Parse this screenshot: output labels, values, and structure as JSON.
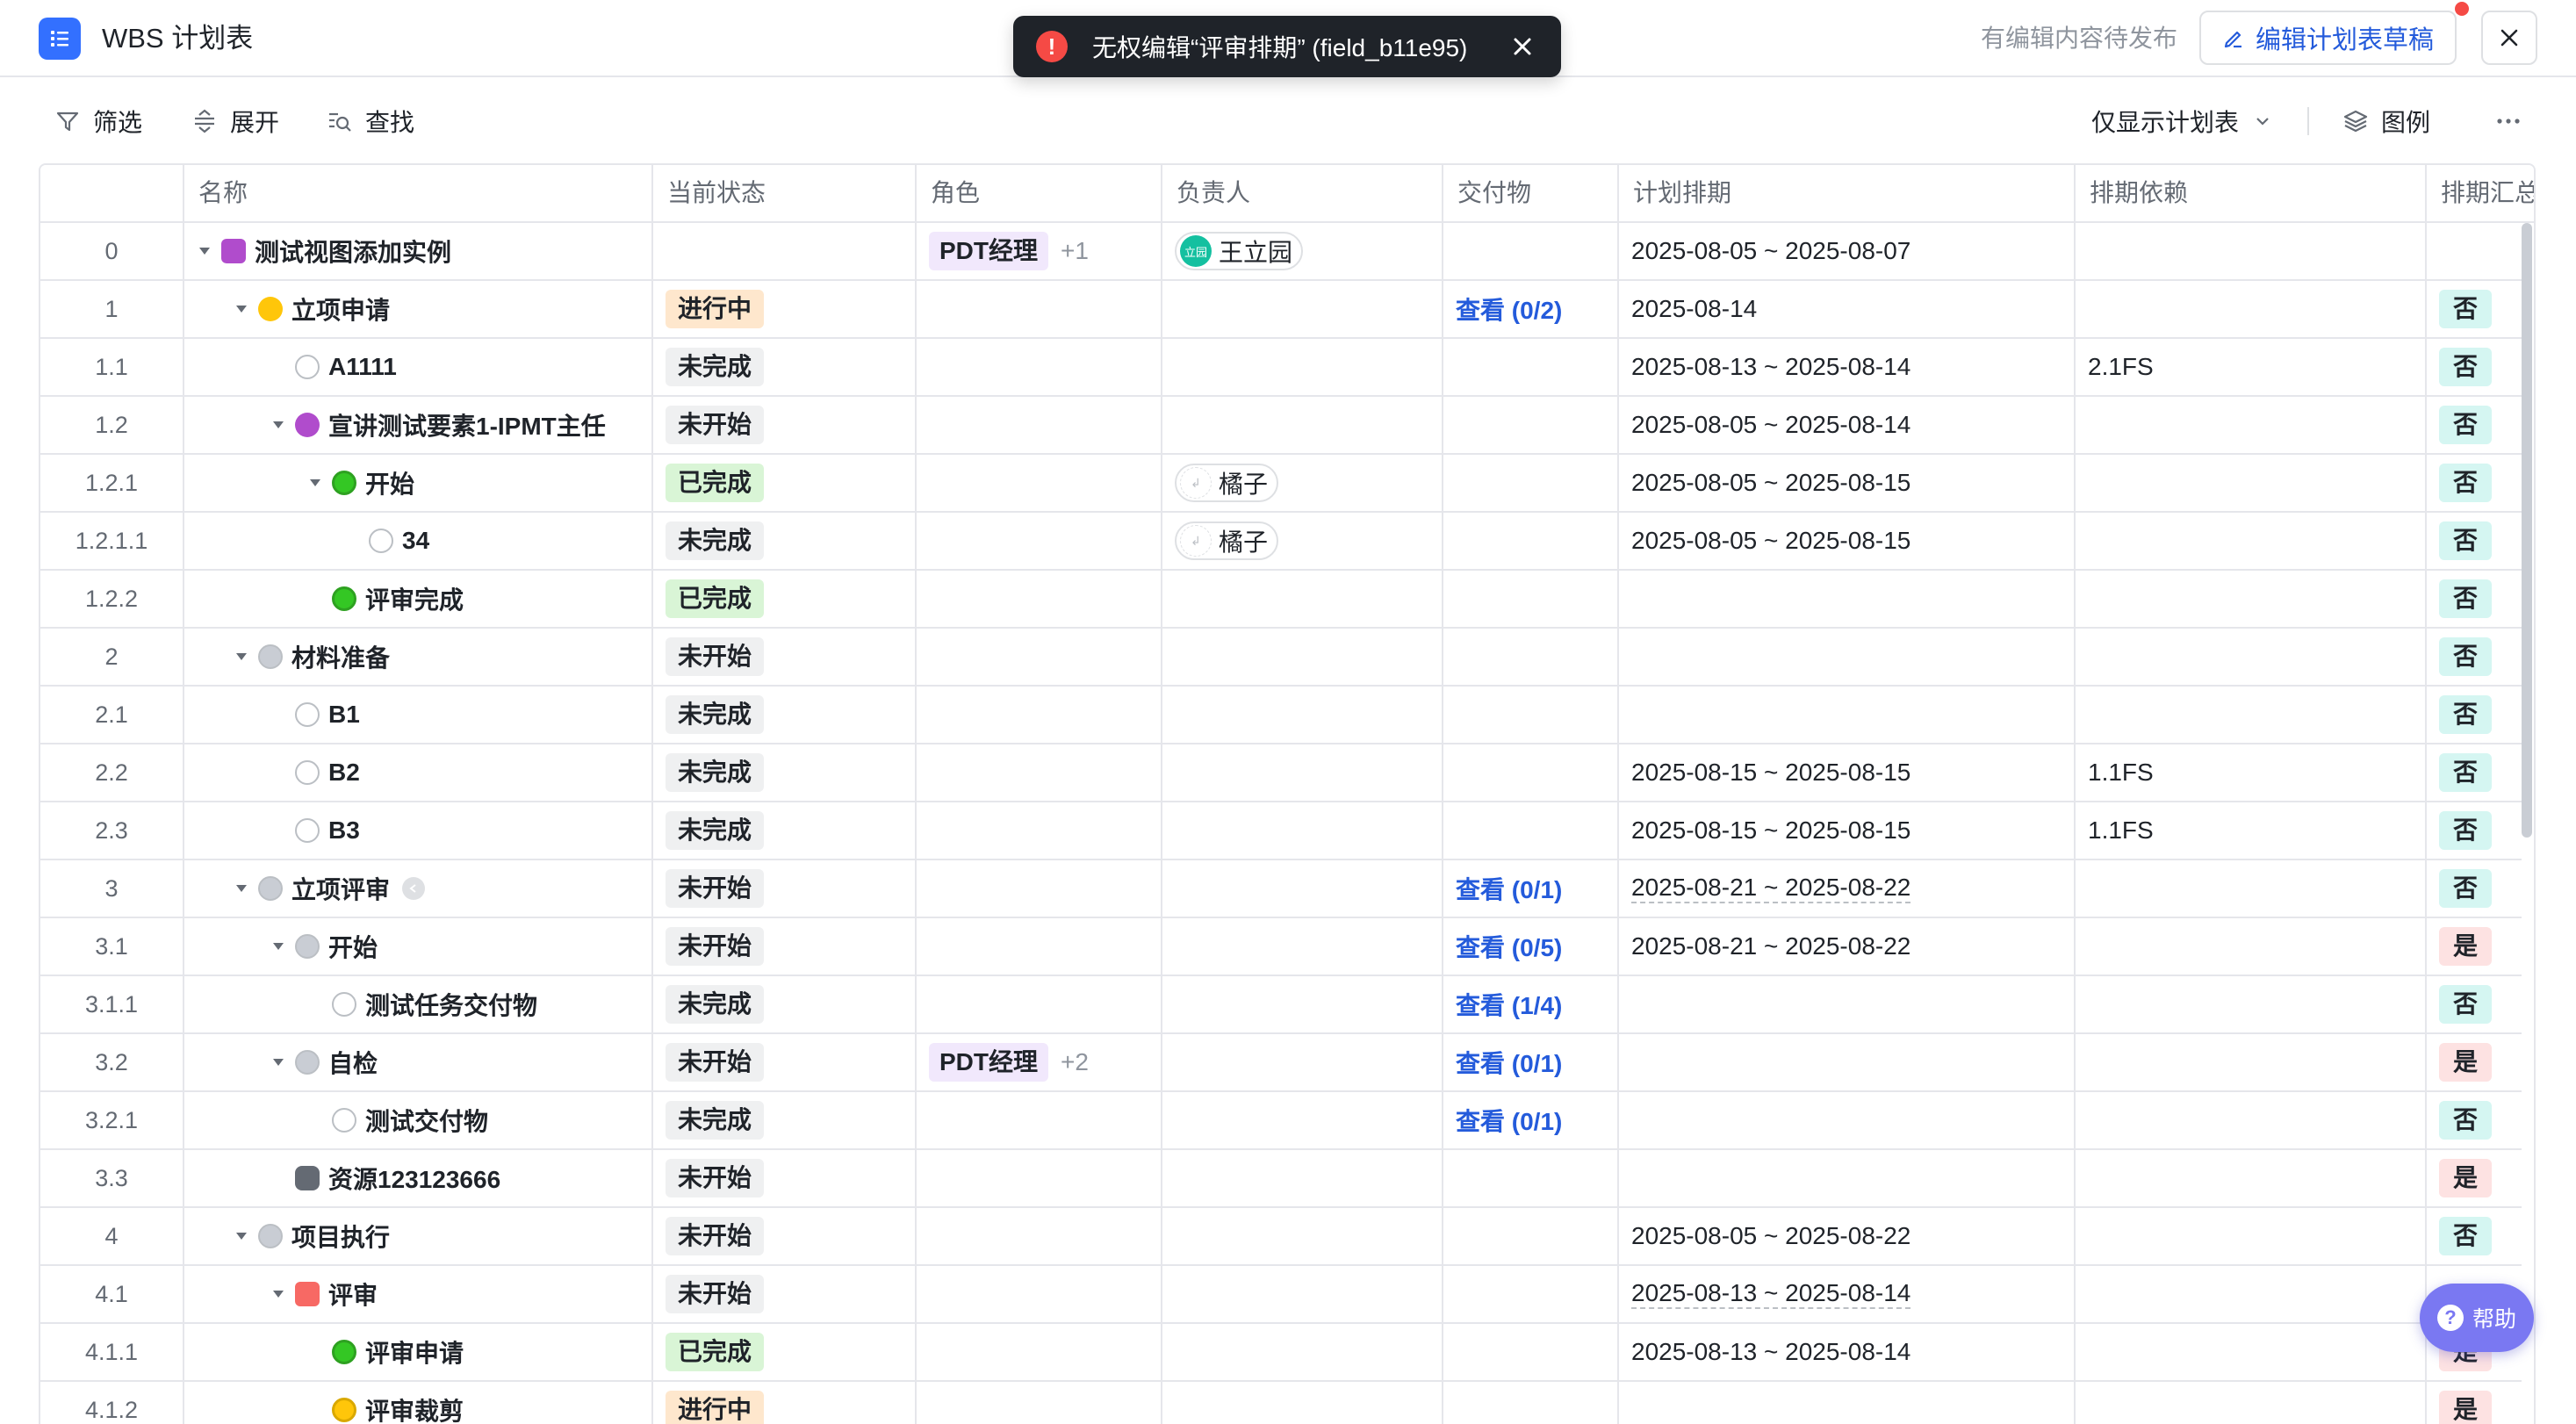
{
  "header": {
    "title": "WBS 计划表",
    "pending_text": "有编辑内容待发布",
    "edit_draft_label": "编辑计划表草稿"
  },
  "toast": {
    "message": "无权编辑“评审排期” (field_b11e95)"
  },
  "toolbar": {
    "filter": "筛选",
    "expand": "展开",
    "find": "查找",
    "view_select": "仅显示计划表",
    "legend": "图例"
  },
  "columns": [
    "名称",
    "当前状态",
    "角色",
    "负责人",
    "交付物",
    "计划排期",
    "排期依赖",
    "排期汇总"
  ],
  "rows": [
    {
      "no": "0",
      "level": 0,
      "arrow": true,
      "icon": "purple-sq",
      "name": "测试视图添加实例",
      "status": "",
      "role": "PDT经理",
      "role_more": "+1",
      "owner": "王立园",
      "owner_avatar": "立园",
      "deliv": "",
      "sched": "2025-08-05 ~ 2025-08-07",
      "dep": "",
      "yn": ""
    },
    {
      "no": "1",
      "level": 1,
      "arrow": true,
      "icon": "yellow-c",
      "name": "立项申请",
      "status": "进行中",
      "role": "",
      "role_more": "",
      "owner": "",
      "owner_avatar": "",
      "deliv": "查看 (0/2)",
      "sched": "2025-08-14",
      "dep": "",
      "yn": "否"
    },
    {
      "no": "1.1",
      "level": 2,
      "arrow": false,
      "icon": "empty",
      "name": "A1111",
      "status": "未完成",
      "role": "",
      "role_more": "",
      "owner": "",
      "owner_avatar": "",
      "deliv": "",
      "sched": "2025-08-13 ~ 2025-08-14",
      "dep": "2.1FS",
      "yn": "否"
    },
    {
      "no": "1.2",
      "level": 2,
      "arrow": true,
      "icon": "purple-c",
      "name": "宣讲测试要素1-IPMT主任",
      "status": "未开始",
      "role": "",
      "role_more": "",
      "owner": "",
      "owner_avatar": "",
      "deliv": "",
      "sched": "2025-08-05 ~ 2025-08-14",
      "dep": "",
      "yn": "否"
    },
    {
      "no": "1.2.1",
      "level": 3,
      "arrow": true,
      "icon": "green",
      "name": "开始",
      "status": "已完成",
      "role": "",
      "role_more": "",
      "owner": "橘子",
      "owner_avatar": "",
      "deliv": "",
      "sched": "2025-08-05 ~ 2025-08-15",
      "dep": "",
      "yn": "否"
    },
    {
      "no": "1.2.1.1",
      "level": 4,
      "arrow": false,
      "icon": "empty",
      "name": "34",
      "status": "未完成",
      "role": "",
      "role_more": "",
      "owner": "橘子",
      "owner_avatar": "",
      "deliv": "",
      "sched": "2025-08-05 ~ 2025-08-15",
      "dep": "",
      "yn": "否"
    },
    {
      "no": "1.2.2",
      "level": 3,
      "arrow": false,
      "icon": "green",
      "name": "评审完成",
      "status": "已完成",
      "role": "",
      "role_more": "",
      "owner": "",
      "owner_avatar": "",
      "deliv": "",
      "sched": "",
      "dep": "",
      "yn": "否"
    },
    {
      "no": "2",
      "level": 1,
      "arrow": true,
      "icon": "gray",
      "name": "材料准备",
      "status": "未开始",
      "role": "",
      "role_more": "",
      "owner": "",
      "owner_avatar": "",
      "deliv": "",
      "sched": "",
      "dep": "",
      "yn": "否"
    },
    {
      "no": "2.1",
      "level": 2,
      "arrow": false,
      "icon": "empty",
      "name": "B1",
      "status": "未完成",
      "role": "",
      "role_more": "",
      "owner": "",
      "owner_avatar": "",
      "deliv": "",
      "sched": "",
      "dep": "",
      "yn": "否"
    },
    {
      "no": "2.2",
      "level": 2,
      "arrow": false,
      "icon": "empty",
      "name": "B2",
      "status": "未完成",
      "role": "",
      "role_more": "",
      "owner": "",
      "owner_avatar": "",
      "deliv": "",
      "sched": "2025-08-15 ~ 2025-08-15",
      "dep": "1.1FS",
      "yn": "否"
    },
    {
      "no": "2.3",
      "level": 2,
      "arrow": false,
      "icon": "empty",
      "name": "B3",
      "status": "未完成",
      "role": "",
      "role_more": "",
      "owner": "",
      "owner_avatar": "",
      "deliv": "",
      "sched": "2025-08-15 ~ 2025-08-15",
      "dep": "1.1FS",
      "yn": "否"
    },
    {
      "no": "3",
      "level": 1,
      "arrow": true,
      "icon": "gray",
      "name": "立项评审",
      "badge": true,
      "status": "未开始",
      "role": "",
      "role_more": "",
      "owner": "",
      "owner_avatar": "",
      "deliv": "查看 (0/1)",
      "sched": "2025-08-21 ~ 2025-08-22",
      "sched_dashed": true,
      "dep": "",
      "yn": "否"
    },
    {
      "no": "3.1",
      "level": 2,
      "arrow": true,
      "icon": "gray",
      "name": "开始",
      "status": "未开始",
      "role": "",
      "role_more": "",
      "owner": "",
      "owner_avatar": "",
      "deliv": "查看 (0/5)",
      "sched": "2025-08-21 ~ 2025-08-22",
      "dep": "",
      "yn": "是"
    },
    {
      "no": "3.1.1",
      "level": 3,
      "arrow": false,
      "icon": "empty",
      "name": "测试任务交付物",
      "status": "未完成",
      "role": "",
      "role_more": "",
      "owner": "",
      "owner_avatar": "",
      "deliv": "查看 (1/4)",
      "sched": "",
      "dep": "",
      "yn": "否"
    },
    {
      "no": "3.2",
      "level": 2,
      "arrow": true,
      "icon": "gray",
      "name": "自检",
      "status": "未开始",
      "role": "PDT经理",
      "role_more": "+2",
      "owner": "",
      "owner_avatar": "",
      "deliv": "查看 (0/1)",
      "sched": "",
      "dep": "",
      "yn": "是"
    },
    {
      "no": "3.2.1",
      "level": 3,
      "arrow": false,
      "icon": "empty",
      "name": "测试交付物",
      "status": "未完成",
      "role": "",
      "role_more": "",
      "owner": "",
      "owner_avatar": "",
      "deliv": "查看 (0/1)",
      "sched": "",
      "dep": "",
      "yn": "否"
    },
    {
      "no": "3.3",
      "level": 2,
      "arrow": false,
      "icon": "dark",
      "name": "资源123123666",
      "status": "未开始",
      "role": "",
      "role_more": "",
      "owner": "",
      "owner_avatar": "",
      "deliv": "",
      "sched": "",
      "dep": "",
      "yn": "是"
    },
    {
      "no": "4",
      "level": 1,
      "arrow": true,
      "icon": "gray",
      "name": "项目执行",
      "status": "未开始",
      "role": "",
      "role_more": "",
      "owner": "",
      "owner_avatar": "",
      "deliv": "",
      "sched": "2025-08-05 ~ 2025-08-22",
      "dep": "",
      "yn": "否"
    },
    {
      "no": "4.1",
      "level": 2,
      "arrow": true,
      "icon": "red",
      "name": "评审",
      "status": "未开始",
      "role": "",
      "role_more": "",
      "owner": "",
      "owner_avatar": "",
      "deliv": "",
      "sched": "2025-08-13 ~ 2025-08-14",
      "sched_dashed": true,
      "dep": "",
      "yn": ""
    },
    {
      "no": "4.1.1",
      "level": 3,
      "arrow": false,
      "icon": "green",
      "name": "评审申请",
      "status": "已完成",
      "role": "",
      "role_more": "",
      "owner": "",
      "owner_avatar": "",
      "deliv": "",
      "sched": "2025-08-13 ~ 2025-08-14",
      "dep": "",
      "yn": "是"
    },
    {
      "no": "4.1.2",
      "level": 3,
      "arrow": false,
      "icon": "yellow",
      "name": "评审裁剪",
      "status": "进行中",
      "role": "",
      "role_more": "",
      "owner": "",
      "owner_avatar": "",
      "deliv": "",
      "sched": "",
      "dep": "",
      "yn": "是"
    }
  ],
  "help": {
    "label": "帮助"
  },
  "colors": {
    "primary": "#3370ff",
    "link": "#245bdb",
    "toast_bg": "#1f2329",
    "error": "#f54a45",
    "help_bg": "#7a78f2"
  }
}
